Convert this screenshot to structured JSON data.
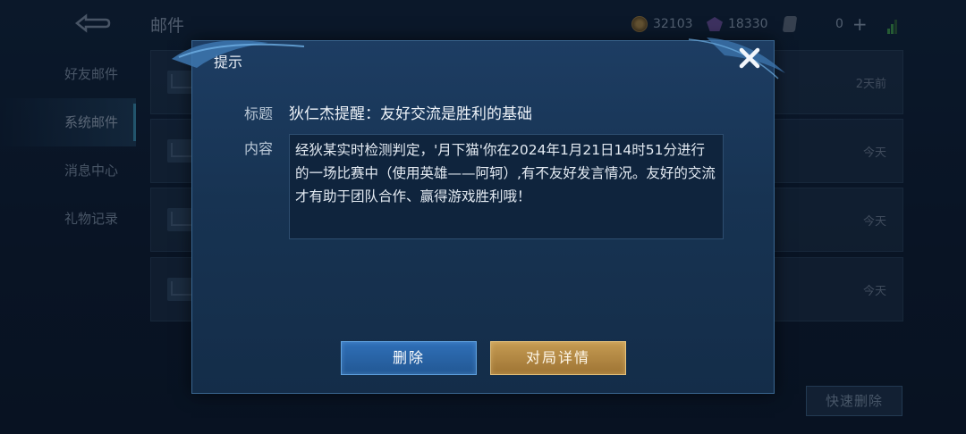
{
  "header": {
    "title": "邮件",
    "gold": "32103",
    "diamonds": "18330",
    "vouchers": "0",
    "back_icon": "back-arrow-icon",
    "gold_icon": "gold-coin-icon",
    "diamond_icon": "diamond-icon",
    "voucher_icon": "voucher-icon",
    "plus_icon": "plus-icon",
    "signal_icon": "signal-icon"
  },
  "sidebar": {
    "items": [
      {
        "label": "好友邮件"
      },
      {
        "label": "系统邮件"
      },
      {
        "label": "消息中心"
      },
      {
        "label": "礼物记录"
      }
    ],
    "active_index": 1
  },
  "mail_list": {
    "rows": [
      {
        "time": "2天前"
      },
      {
        "time": "今天"
      },
      {
        "time": "今天"
      },
      {
        "time": "今天"
      }
    ],
    "quick_delete_label": "快速删除"
  },
  "dialog": {
    "title": "提示",
    "subject_label": "标题",
    "subject": "狄仁杰提醒：友好交流是胜利的基础",
    "content_label": "内容",
    "content": "经狄某实时检测判定，'月下猫'你在2024年1月21日14时51分进行的一场比赛中（使用英雄——阿轲）,有不友好发言情况。友好的交流才有助于团队合作、赢得游戏胜利哦！",
    "delete_label": "删除",
    "detail_label": "对局详情",
    "close_icon": "close-icon"
  },
  "colors": {
    "dialog_bg": "#1a3858",
    "delete_button": "#2a64a6",
    "detail_button": "#b38744",
    "text_primary": "#edf2f8"
  }
}
